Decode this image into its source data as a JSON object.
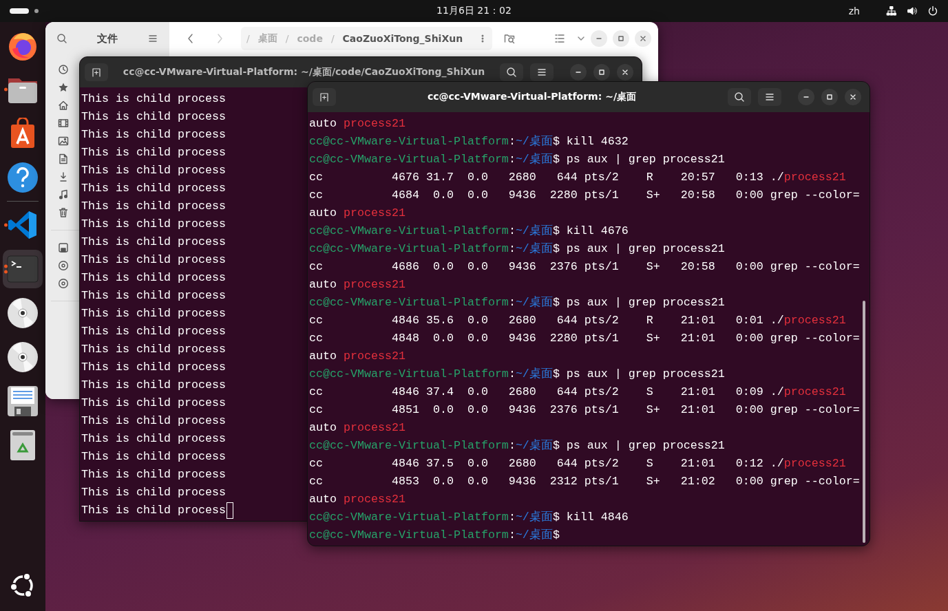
{
  "top_bar": {
    "clock": "11月6日 21：02",
    "input_method": "zh"
  },
  "dock": {
    "apps": [
      {
        "kind": "firefox",
        "running": false,
        "selected": false
      },
      {
        "kind": "files",
        "running": true,
        "selected": false
      },
      {
        "kind": "app-center",
        "running": false,
        "selected": false
      },
      {
        "kind": "help",
        "running": false,
        "selected": false
      },
      {
        "kind": "separator"
      },
      {
        "kind": "vscode",
        "running": true,
        "selected": false
      },
      {
        "kind": "terminal",
        "running": true,
        "multiple_windows": true,
        "selected": true
      },
      {
        "kind": "disc",
        "running": false,
        "selected": false
      },
      {
        "kind": "disc",
        "running": false,
        "selected": false
      },
      {
        "kind": "floppy",
        "running": false,
        "selected": false
      },
      {
        "kind": "trash",
        "running": false,
        "selected": false
      }
    ]
  },
  "file_manager": {
    "title": "文件",
    "forward_enabled": false,
    "breadcrumb": [
      {
        "label": "/",
        "kind": "separator"
      },
      {
        "label": "桌面",
        "kind": "crumb",
        "current": false
      },
      {
        "label": "/",
        "kind": "separator"
      },
      {
        "label": "code",
        "kind": "crumb",
        "current": false
      },
      {
        "label": "/",
        "kind": "separator"
      },
      {
        "label": "CaoZuoXiTong_ShiXun",
        "kind": "crumb",
        "current": true
      }
    ],
    "sidebar": [
      {
        "kind": "recent"
      },
      {
        "kind": "starred"
      },
      {
        "kind": "home"
      },
      {
        "kind": "videos"
      },
      {
        "kind": "pictures"
      },
      {
        "kind": "documents"
      },
      {
        "kind": "downloads"
      },
      {
        "kind": "music"
      },
      {
        "kind": "trash"
      },
      {
        "kind": "divider"
      },
      {
        "kind": "drive"
      },
      {
        "kind": "disc"
      },
      {
        "kind": "disc"
      },
      {
        "kind": "divider"
      }
    ]
  },
  "terminal_back": {
    "title": "cc@cc-VMware-Virtual-Platform: ~/桌面/code/CaoZuoXiTong_ShiXun",
    "cursor": true,
    "lines": [
      "This is child process",
      "This is child process",
      "This is child process",
      "This is child process",
      "This is child process",
      "This is child process",
      "This is child process",
      "This is child process",
      "This is child process",
      "This is child process",
      "This is child process",
      "This is child process",
      "This is child process",
      "This is child process",
      "This is child process",
      "This is child process",
      "This is child process",
      "This is child process",
      "This is child process",
      "This is child process",
      "This is child process",
      "This is child process",
      "This is child process",
      "This is child process"
    ]
  },
  "terminal_front": {
    "title": "cc@cc-VMware-Virtual-Platform: ~/桌面",
    "lines": [
      [
        {
          "kind": "plain",
          "text": "auto "
        },
        {
          "kind": "match",
          "text": "process21"
        }
      ],
      [
        {
          "kind": "user",
          "text": "cc@cc-VMware-Virtual-Platform"
        },
        {
          "kind": "plain",
          "text": ":"
        },
        {
          "kind": "path",
          "text": "~/桌面"
        },
        {
          "kind": "plain",
          "text": "$ kill 4632"
        }
      ],
      [
        {
          "kind": "user",
          "text": "cc@cc-VMware-Virtual-Platform"
        },
        {
          "kind": "plain",
          "text": ":"
        },
        {
          "kind": "path",
          "text": "~/桌面"
        },
        {
          "kind": "plain",
          "text": "$ ps aux | grep process21"
        }
      ],
      [
        {
          "kind": "plain",
          "text": "cc          4676 31.7  0.0   2680   644 pts/2    R    20:57   0:13 ./"
        },
        {
          "kind": "match",
          "text": "process21"
        }
      ],
      [
        {
          "kind": "plain",
          "text": "cc          4684  0.0  0.0   9436  2280 pts/1    S+   20:58   0:00 grep --color="
        }
      ],
      [
        {
          "kind": "plain",
          "text": "auto "
        },
        {
          "kind": "match",
          "text": "process21"
        }
      ],
      [
        {
          "kind": "user",
          "text": "cc@cc-VMware-Virtual-Platform"
        },
        {
          "kind": "plain",
          "text": ":"
        },
        {
          "kind": "path",
          "text": "~/桌面"
        },
        {
          "kind": "plain",
          "text": "$ kill 4676"
        }
      ],
      [
        {
          "kind": "user",
          "text": "cc@cc-VMware-Virtual-Platform"
        },
        {
          "kind": "plain",
          "text": ":"
        },
        {
          "kind": "path",
          "text": "~/桌面"
        },
        {
          "kind": "plain",
          "text": "$ ps aux | grep process21"
        }
      ],
      [
        {
          "kind": "plain",
          "text": "cc          4686  0.0  0.0   9436  2376 pts/1    S+   20:58   0:00 grep --color="
        }
      ],
      [
        {
          "kind": "plain",
          "text": "auto "
        },
        {
          "kind": "match",
          "text": "process21"
        }
      ],
      [
        {
          "kind": "user",
          "text": "cc@cc-VMware-Virtual-Platform"
        },
        {
          "kind": "plain",
          "text": ":"
        },
        {
          "kind": "path",
          "text": "~/桌面"
        },
        {
          "kind": "plain",
          "text": "$ ps aux | grep process21"
        }
      ],
      [
        {
          "kind": "plain",
          "text": "cc          4846 35.6  0.0   2680   644 pts/2    R    21:01   0:01 ./"
        },
        {
          "kind": "match",
          "text": "process21"
        }
      ],
      [
        {
          "kind": "plain",
          "text": "cc          4848  0.0  0.0   9436  2280 pts/1    S+   21:01   0:00 grep --color="
        }
      ],
      [
        {
          "kind": "plain",
          "text": "auto "
        },
        {
          "kind": "match",
          "text": "process21"
        }
      ],
      [
        {
          "kind": "user",
          "text": "cc@cc-VMware-Virtual-Platform"
        },
        {
          "kind": "plain",
          "text": ":"
        },
        {
          "kind": "path",
          "text": "~/桌面"
        },
        {
          "kind": "plain",
          "text": "$ ps aux | grep process21"
        }
      ],
      [
        {
          "kind": "plain",
          "text": "cc          4846 37.4  0.0   2680   644 pts/2    S    21:01   0:09 ./"
        },
        {
          "kind": "match",
          "text": "process21"
        }
      ],
      [
        {
          "kind": "plain",
          "text": "cc          4851  0.0  0.0   9436  2376 pts/1    S+   21:01   0:00 grep --color="
        }
      ],
      [
        {
          "kind": "plain",
          "text": "auto "
        },
        {
          "kind": "match",
          "text": "process21"
        }
      ],
      [
        {
          "kind": "user",
          "text": "cc@cc-VMware-Virtual-Platform"
        },
        {
          "kind": "plain",
          "text": ":"
        },
        {
          "kind": "path",
          "text": "~/桌面"
        },
        {
          "kind": "plain",
          "text": "$ ps aux | grep process21"
        }
      ],
      [
        {
          "kind": "plain",
          "text": "cc          4846 37.5  0.0   2680   644 pts/2    S    21:01   0:12 ./"
        },
        {
          "kind": "match",
          "text": "process21"
        }
      ],
      [
        {
          "kind": "plain",
          "text": "cc          4853  0.0  0.0   9436  2312 pts/1    S+   21:02   0:00 grep --color="
        }
      ],
      [
        {
          "kind": "plain",
          "text": "auto "
        },
        {
          "kind": "match",
          "text": "process21"
        }
      ],
      [
        {
          "kind": "user",
          "text": "cc@cc-VMware-Virtual-Platform"
        },
        {
          "kind": "plain",
          "text": ":"
        },
        {
          "kind": "path",
          "text": "~/桌面"
        },
        {
          "kind": "plain",
          "text": "$ kill 4846"
        }
      ],
      [
        {
          "kind": "user",
          "text": "cc@cc-VMware-Virtual-Platform"
        },
        {
          "kind": "plain",
          "text": ":"
        },
        {
          "kind": "path",
          "text": "~/桌面"
        },
        {
          "kind": "plain",
          "text": "$"
        }
      ]
    ]
  }
}
